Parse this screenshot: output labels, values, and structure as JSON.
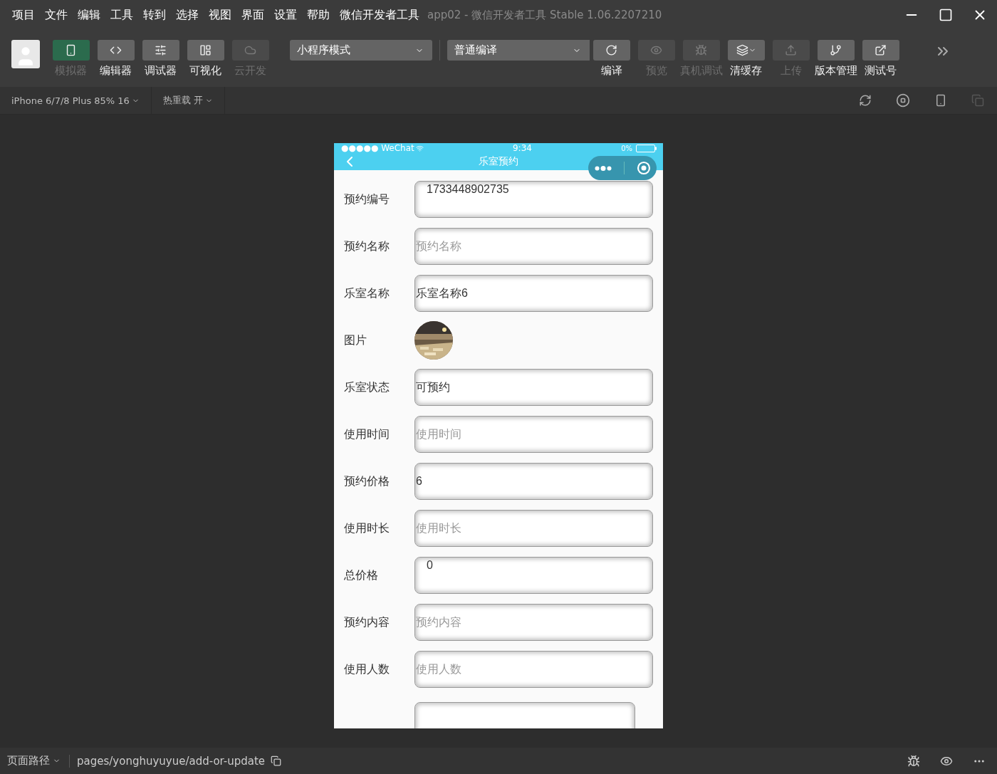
{
  "menu": [
    "项目",
    "文件",
    "编辑",
    "工具",
    "转到",
    "选择",
    "视图",
    "界面",
    "设置",
    "帮助",
    "微信开发者工具"
  ],
  "window": {
    "title": "app02 - 微信开发者工具 Stable 1.06.2207210"
  },
  "left_tools": [
    {
      "kind": "phone",
      "label": "模拟器",
      "selected": true,
      "disabled": false
    },
    {
      "kind": "code",
      "label": "编辑器",
      "selected": false,
      "disabled": false
    },
    {
      "kind": "sliders",
      "label": "调试器",
      "selected": false,
      "disabled": false
    },
    {
      "kind": "layout",
      "label": "可视化",
      "selected": false,
      "disabled": false
    },
    {
      "kind": "cloud",
      "label": "云开发",
      "selected": false,
      "disabled": true
    }
  ],
  "mode_select": {
    "value": "小程序模式"
  },
  "compile_select": {
    "value": "普通编译"
  },
  "right_tools": [
    {
      "kind": "refresh",
      "label": "编译",
      "disabled": false
    },
    {
      "kind": "eye",
      "label": "预览",
      "disabled": true
    },
    {
      "kind": "bug",
      "label": "真机调试",
      "disabled": true
    },
    {
      "kind": "layers",
      "label": "清缓存",
      "disabled": false
    },
    {
      "kind": "upload",
      "label": "上传",
      "disabled": true
    },
    {
      "kind": "branch",
      "label": "版本管理",
      "disabled": false
    },
    {
      "kind": "external",
      "label": "测试号",
      "disabled": false
    }
  ],
  "sub_bar": {
    "device": "iPhone 6/7/8 Plus 85% 16",
    "hot_reload": "热重载 开"
  },
  "phone": {
    "carrier": "●●●●● WeChat",
    "time": "9:34",
    "battery": "0%",
    "nav_title": "乐室预约",
    "fields": [
      {
        "kind": "input",
        "label": "预约编号",
        "value": "1733448902735",
        "indented": true
      },
      {
        "kind": "input",
        "label": "预约名称",
        "placeholder": "预约名称"
      },
      {
        "kind": "input",
        "label": "乐室名称",
        "value": "乐室名称6"
      },
      {
        "label": "图片"
      },
      {
        "kind": "input",
        "label": "乐室状态",
        "value": "可预约"
      },
      {
        "kind": "input",
        "label": "使用时间",
        "placeholder": "使用时间"
      },
      {
        "kind": "input",
        "label": "预约价格",
        "value": "6"
      },
      {
        "kind": "input",
        "label": "使用时长",
        "placeholder": "使用时长"
      },
      {
        "kind": "input",
        "label": "总价格",
        "value": "0",
        "indented": true
      },
      {
        "kind": "input",
        "label": "预约内容",
        "placeholder": "预约内容"
      },
      {
        "kind": "input",
        "label": "使用人数",
        "placeholder": "使用人数"
      },
      {
        "kind": "partial"
      }
    ]
  },
  "status_bar": {
    "path_label": "页面路径",
    "path": "pages/yonghuyuyue/add-or-update"
  }
}
